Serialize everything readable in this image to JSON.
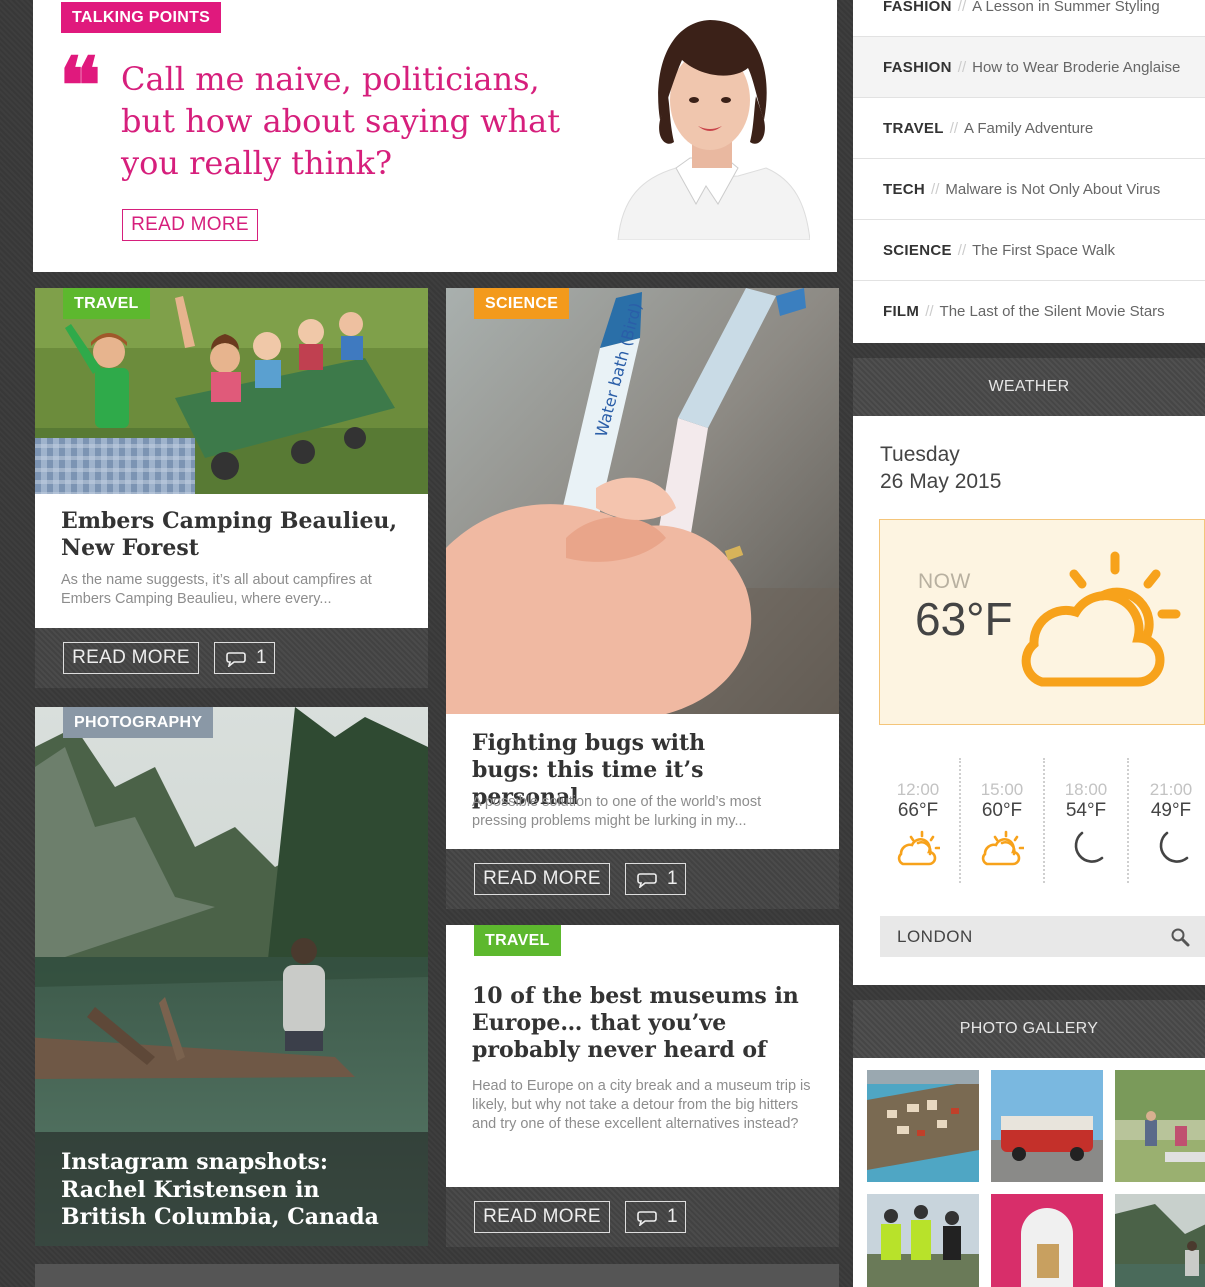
{
  "talking_points": {
    "tag": "TALKING POINTS",
    "quote_mark": "❝",
    "quote": "Call me naive, politicians, but how about saying what you really think?",
    "read_more": "READ MORE"
  },
  "cards": {
    "travel1": {
      "tag": "TRAVEL",
      "tag_color": "#5db82e",
      "title": "Embers Camping Beaulieu, New Forest",
      "excerpt": "As the name suggests, it’s all about campfires at Embers Camping Beaulieu, where every...",
      "read_more": "READ MORE",
      "comments": "1"
    },
    "science": {
      "tag": "SCIENCE",
      "tag_color": "#f39a1c",
      "title": "Fighting bugs with bugs: this time it’s personal",
      "excerpt": "A possible solution to one of the world’s most pressing problems might be lurking in my...",
      "read_more": "READ MORE",
      "comments": "1",
      "pen_text": "Water bath (Bird)"
    },
    "photography": {
      "tag": "PHOTOGRAPHY",
      "tag_color": "#8a98a6",
      "title": "Instagram snapshots: Rachel Kristensen in British Columbia, Canada"
    },
    "travel2": {
      "tag": "TRAVEL",
      "tag_color": "#5db82e",
      "title": "10 of the best museums in Europe… that you’ve probably never heard of",
      "excerpt": "Head to Europe on a city break and a museum trip is likely, but why not take a detour from the big hitters and try one of these excellent alternatives instead?",
      "read_more": "READ MORE",
      "comments": "1"
    }
  },
  "topics": [
    {
      "category": "FASHION",
      "title": "A Lesson in Summer Styling",
      "active": false
    },
    {
      "category": "FASHION",
      "title": "How to Wear Broderie Anglaise",
      "active": true
    },
    {
      "category": "TRAVEL",
      "title": "A Family Adventure",
      "active": false
    },
    {
      "category": "TECH",
      "title": "Malware is Not Only About Virus",
      "active": false
    },
    {
      "category": "SCIENCE",
      "title": "The First Space Walk",
      "active": false
    },
    {
      "category": "FILM",
      "title": "The Last of the Silent Movie Stars",
      "active": false
    }
  ],
  "topic_separator": "//",
  "weather": {
    "heading": "WEATHER",
    "day": "Tuesday",
    "date": "26 May 2015",
    "now_label": "NOW",
    "now_temp": "63°F",
    "now_icon": "partly-sunny-icon",
    "accent": "#f7a21b",
    "hours": [
      {
        "time": "12:00",
        "temp": "66°F",
        "icon": "partly-sunny-icon"
      },
      {
        "time": "15:00",
        "temp": "60°F",
        "icon": "partly-sunny-icon"
      },
      {
        "time": "18:00",
        "temp": "54°F",
        "icon": "moon-icon"
      },
      {
        "time": "21:00",
        "temp": "49°F",
        "icon": "moon-icon"
      }
    ],
    "location": "LONDON"
  },
  "gallery": {
    "heading": "PHOTO GALLERY"
  },
  "colors": {
    "brand_pink": "#e0197d",
    "travel_green": "#5db82e",
    "science_orange": "#f39a1c",
    "photo_gray": "#8a98a6"
  }
}
